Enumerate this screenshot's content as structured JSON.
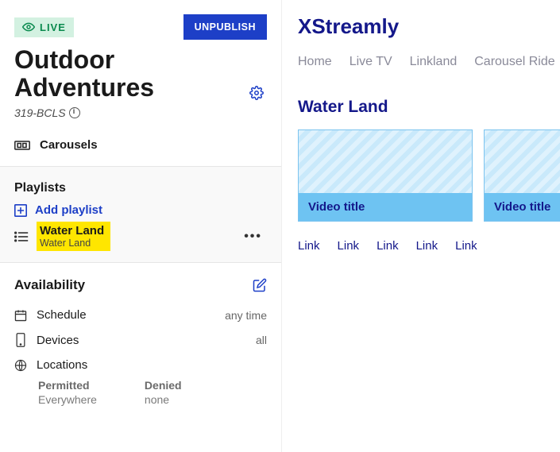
{
  "header": {
    "live_badge": "LIVE",
    "unpublish": "UNPUBLISH",
    "title": "Outdoor Adventures",
    "ref_id": "319-BCLS",
    "carousels_label": "Carousels"
  },
  "playlists": {
    "section_title": "Playlists",
    "add_label": "Add playlist",
    "items": [
      {
        "title": "Water Land",
        "subtitle": "Water Land"
      }
    ]
  },
  "availability": {
    "section_title": "Availability",
    "schedule": {
      "label": "Schedule",
      "value": "any time"
    },
    "devices": {
      "label": "Devices",
      "value": "all"
    },
    "locations": {
      "label": "Locations",
      "permitted_label": "Permitted",
      "permitted_value": "Everywhere",
      "denied_label": "Denied",
      "denied_value": "none"
    }
  },
  "preview": {
    "brand": "XStreamly",
    "nav": [
      "Home",
      "Live TV",
      "Linkland",
      "Carousel Ride"
    ],
    "carousel_title": "Water Land",
    "card_title": "Video title",
    "links": [
      "Link",
      "Link",
      "Link",
      "Link",
      "Link"
    ]
  }
}
